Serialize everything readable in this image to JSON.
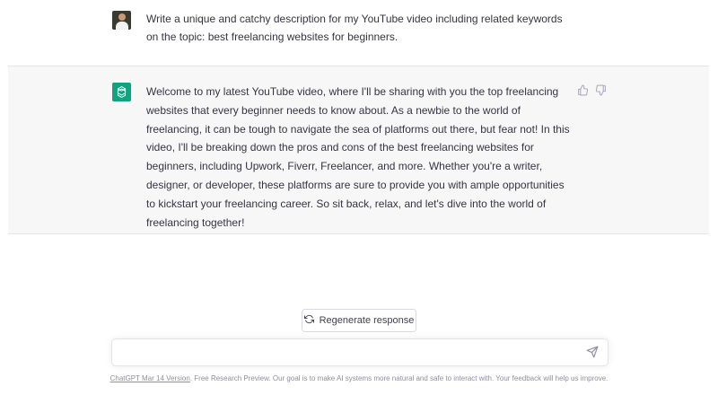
{
  "conversation": {
    "user_message": "Write a unique and catchy description for my YouTube video including related keywords on the topic: best freelancing websites for beginners.",
    "assistant_message": "Welcome to my latest YouTube video, where I'll be sharing with you the top freelancing websites that every beginner needs to know about. As a newbie to the world of freelancing, it can be tough to navigate the sea of platforms out there, but fear not! In this video, I'll be breaking down the pros and cons of the best freelancing websites for beginners, including Upwork, Fiverr, Freelancer, and more. Whether you're a writer, designer, or developer, these platforms are sure to provide you with ample opportunities to kickstart your freelancing career. So sit back, relax, and let's dive into the world of freelancing together!"
  },
  "icons": {
    "user_avatar": "user-avatar-photo",
    "assistant_avatar": "openai-logo-icon",
    "thumbs_up": "thumbs-up-icon",
    "thumbs_down": "thumbs-down-icon",
    "regenerate": "refresh-icon",
    "send": "paper-plane-icon"
  },
  "actions": {
    "regenerate_label": "Regenerate response"
  },
  "composer": {
    "value": "",
    "placeholder": ""
  },
  "footer": {
    "version_link": "ChatGPT Mar 14 Version",
    "text": ". Free Research Preview. Our goal is to make AI systems more natural and safe to interact with. Your feedback will help us improve."
  },
  "colors": {
    "accent": "#10a37f",
    "assistant_bg": "#f7f7f8",
    "text": "#343541",
    "muted": "#8e8ea0"
  }
}
